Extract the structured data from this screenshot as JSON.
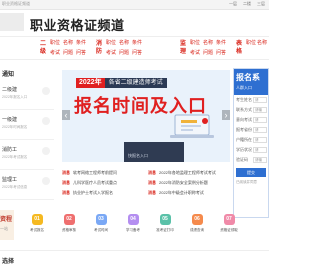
{
  "topbar": {
    "left": "职业资格证频道",
    "right": [
      "一层",
      "二楼",
      "三层"
    ]
  },
  "header": {
    "title": "职业资格证频道"
  },
  "catnav": [
    {
      "big": [
        "二",
        "级"
      ],
      "links": [
        "职位",
        "名称",
        "条件",
        "考试",
        "问题",
        "问答"
      ]
    },
    {
      "big": [
        "消",
        "防"
      ],
      "links": [
        "职位",
        "名称",
        "条件",
        "考试",
        "问题",
        "问答"
      ]
    },
    {
      "big": [
        "监",
        "理"
      ],
      "links": [
        "职位",
        "名称",
        "条件",
        "考试",
        "问题",
        "问答"
      ]
    },
    {
      "big": [
        "表",
        "格"
      ],
      "links": [
        "职位",
        "名称"
      ]
    }
  ],
  "left": {
    "heading": "通知",
    "items": [
      {
        "title": "二级建",
        "sub": "2022年报名入口"
      },
      {
        "title": "一级建",
        "sub": "2022年时间报名"
      },
      {
        "title": "消防工",
        "sub": "2022年考试报名"
      },
      {
        "title": "监理工",
        "sub": "2022年考试信息"
      }
    ]
  },
  "banner": {
    "year": "2022年",
    "sub": "各省二级建造师考试",
    "main": "报名时间及入口",
    "small": "",
    "dark_label": "快报名入口",
    "arrow_left": "‹",
    "arrow_right": "›"
  },
  "news": [
    {
      "tag": "消息",
      "text": "软考网络工程师考前提问",
      "tag2": "消息",
      "text2": "2022年各地监理工程师考试考试"
    },
    {
      "tag": "消息",
      "text": "儿科学医疗人员考试重点",
      "tag2": "消息",
      "text2": "2022年消防安全案例分析题"
    },
    {
      "tag": "消息",
      "text": "执业护士考试入学报名",
      "tag2": "消息",
      "text2": "2022年中级会计职称考试"
    }
  ],
  "right": {
    "title": "报名系",
    "sub": "人群入口",
    "rows": [
      {
        "label": "考生姓名",
        "value": "请"
      },
      {
        "label": "联系方式",
        "value": "请输"
      },
      {
        "label": "意向考试",
        "value": "请"
      },
      {
        "label": "报考省份",
        "value": "请"
      },
      {
        "label": "户籍所在",
        "value": "请"
      },
      {
        "label": "学历状况",
        "value": "请"
      },
      {
        "label": "验证码",
        "value": "请输"
      }
    ],
    "button": "提交",
    "note": "已阅读并同意"
  },
  "quick": {
    "big": "资程",
    "big_sub": "一站",
    "items": [
      {
        "label": "考试报名",
        "icon": "01",
        "color": "#f5b921"
      },
      {
        "label": "资格审核",
        "icon": "02",
        "color": "#ef6f6f"
      },
      {
        "label": "考试时间",
        "icon": "03",
        "color": "#7aa8f5"
      },
      {
        "label": "学习备考",
        "icon": "04",
        "color": "#b48ef0"
      },
      {
        "label": "准考证打印",
        "icon": "05",
        "color": "#5ac1a8"
      },
      {
        "label": "成绩查询",
        "icon": "06",
        "color": "#f58a4c"
      },
      {
        "label": "资格证领取",
        "icon": "07",
        "color": "#f08aa8"
      }
    ]
  },
  "bottom": {
    "heading": "选择"
  }
}
